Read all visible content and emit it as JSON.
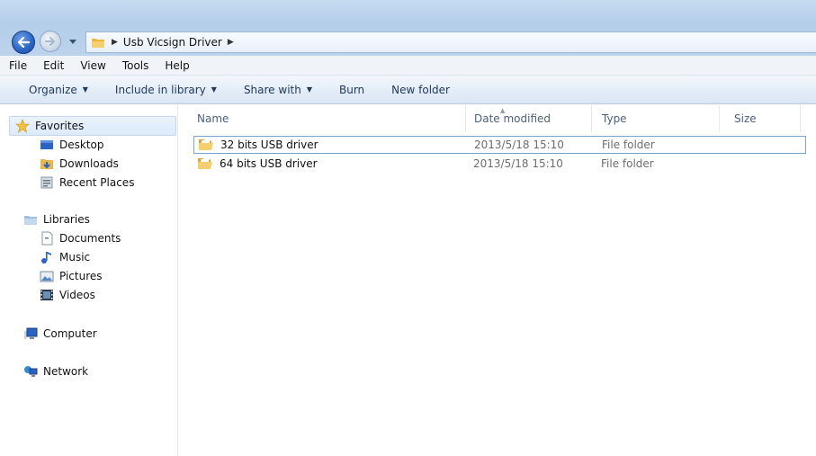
{
  "address": {
    "path_segments": [
      "Usb Vicsign Driver"
    ]
  },
  "menu": [
    "File",
    "Edit",
    "View",
    "Tools",
    "Help"
  ],
  "commands": {
    "organize": "Organize",
    "include_in_library": "Include in library",
    "share_with": "Share with",
    "burn": "Burn",
    "new_folder": "New folder"
  },
  "nav": {
    "favorites": "Favorites",
    "desktop": "Desktop",
    "downloads": "Downloads",
    "recent_places": "Recent Places",
    "libraries": "Libraries",
    "documents": "Documents",
    "music": "Music",
    "pictures": "Pictures",
    "videos": "Videos",
    "computer": "Computer",
    "network": "Network"
  },
  "columns": {
    "name": "Name",
    "date_modified": "Date modified",
    "type": "Type",
    "size": "Size"
  },
  "files": [
    {
      "name": "32 bits USB driver",
      "date": "2013/5/18 15:10",
      "type": "File folder"
    },
    {
      "name": "64 bits USB driver",
      "date": "2013/5/18 15:10",
      "type": "File folder"
    }
  ],
  "colors": {
    "accent": "#2a63c4",
    "folder": "#e8b84a",
    "selection_border": "#7da2ce"
  }
}
